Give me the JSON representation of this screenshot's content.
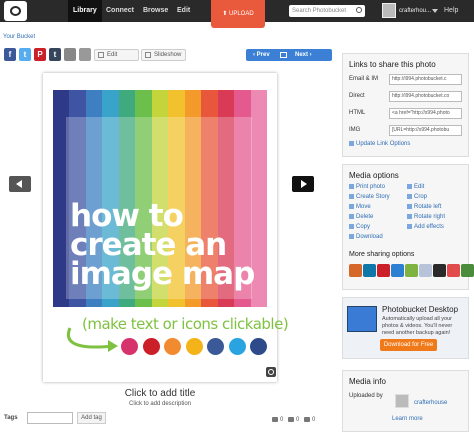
{
  "topnav": {
    "items": [
      "Library",
      "Connect",
      "Browse",
      "Edit"
    ],
    "upload_label": "⬆ UPLOAD",
    "search_placeholder": "Search Photobucket",
    "username": "crafterhou...",
    "help": "Help"
  },
  "breadcrumb": "Your Bucket",
  "share_icons": [
    {
      "name": "facebook",
      "glyph": "f",
      "color": "#3b5998"
    },
    {
      "name": "twitter",
      "glyph": "t",
      "color": "#55acee"
    },
    {
      "name": "pinterest",
      "glyph": "P",
      "color": "#cb2027"
    },
    {
      "name": "tumblr",
      "glyph": "t",
      "color": "#35465c"
    }
  ],
  "toolbar": {
    "edit_label": "Edit",
    "slideshow_label": "Slideshow"
  },
  "pager": {
    "prev": "‹ Prev",
    "next": "Next ›"
  },
  "photo": {
    "headline_lines": [
      "how to",
      "create an",
      "image map"
    ],
    "subline": "(make text or icons clickable)",
    "stripe_colors": [
      "#2e3a87",
      "#3f54a3",
      "#3e7fc2",
      "#3aa3c9",
      "#3faa7e",
      "#6cbf4a",
      "#c4d43b",
      "#f2c22e",
      "#f39a2a",
      "#e8573b",
      "#d93a55",
      "#e45a8f",
      "#ec8ab4"
    ],
    "social_icons": [
      {
        "name": "instagram",
        "color": "#d6336c"
      },
      {
        "name": "pinterest",
        "color": "#cb2027"
      },
      {
        "name": "email",
        "color": "#f28b30"
      },
      {
        "name": "flickr",
        "color": "#f5b31a"
      },
      {
        "name": "facebook",
        "color": "#3b5998"
      },
      {
        "name": "twitter",
        "color": "#2aa4e0"
      },
      {
        "name": "facebook",
        "color": "#2d4a8a"
      }
    ]
  },
  "title_prompt": "Click to add title",
  "description_prompt": "Click to add description",
  "tags": {
    "label": "Tags",
    "add_button": "Add tag"
  },
  "stats": {
    "views": "0",
    "comments": "0",
    "likes": "0"
  },
  "links_panel": {
    "title": "Links to share this photo",
    "rows": [
      {
        "label": "Email & IM",
        "value": "http://i994.photobucket.c"
      },
      {
        "label": "Direct",
        "value": "http://i994.photobucket.co"
      },
      {
        "label": "HTML",
        "value": "<a href=\"http://s994.photo"
      },
      {
        "label": "IMG",
        "value": "[URL=http://s994.photobu"
      }
    ],
    "update_link": "Update Link Options"
  },
  "media_options": {
    "title": "Media options",
    "left": [
      "Print photo",
      "Create Story",
      "Move",
      "Delete",
      "Copy",
      "Download"
    ],
    "right": [
      "Edit",
      "Crop",
      "Rotate left",
      "Rotate right",
      "Add effects"
    ],
    "more_sharing": "More sharing options",
    "more_icons": [
      "#d5672a",
      "#0e76a8",
      "#cb2027",
      "#2c7fd1",
      "#7fb341",
      "#b7c3d8",
      "#2a2a2a",
      "#e14b4b",
      "#4a8c3c"
    ]
  },
  "promo": {
    "title": "Photobucket Desktop",
    "text": "Automatically upload all your photos & videos. You'll never need another backup again!",
    "button": "Download for Free"
  },
  "media_info": {
    "title": "Media info",
    "uploaded_by_label": "Uploaded by",
    "uploader": "crafterhouse",
    "learn_more": "Learn more"
  }
}
